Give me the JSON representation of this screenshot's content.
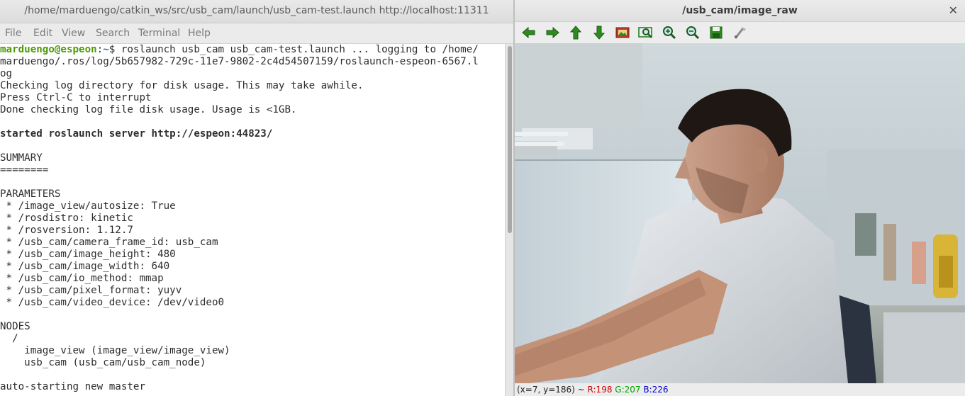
{
  "terminal": {
    "title": "/home/marduengo/catkin_ws/src/usb_cam/launch/usb_cam-test.launch http://localhost:11311",
    "menu": [
      "File",
      "Edit",
      "View",
      "Search",
      "Terminal",
      "Help"
    ],
    "prompt_user": "marduengo@espeon",
    "prompt_sep": ":",
    "prompt_path": "~",
    "prompt_cmd": "$ roslaunch usb_cam usb_cam-test.launch ... logging to /home/",
    "lines": [
      "marduengo/.ros/log/5b657982-729c-11e7-9802-2c4d54507159/roslaunch-espeon-6567.l",
      "og",
      "Checking log directory for disk usage. This may take awhile.",
      "Press Ctrl-C to interrupt",
      "Done checking log file disk usage. Usage is <1GB.",
      "",
      "started roslaunch server http://espeon:44823/",
      "",
      "SUMMARY",
      "========",
      "",
      "PARAMETERS",
      " * /image_view/autosize: True",
      " * /rosdistro: kinetic",
      " * /rosversion: 1.12.7",
      " * /usb_cam/camera_frame_id: usb_cam",
      " * /usb_cam/image_height: 480",
      " * /usb_cam/image_width: 640",
      " * /usb_cam/io_method: mmap",
      " * /usb_cam/pixel_format: yuyv",
      " * /usb_cam/video_device: /dev/video0",
      "",
      "NODES",
      "  /",
      "    image_view (image_view/image_view)",
      "    usb_cam (usb_cam/usb_cam_node)",
      "",
      "auto-starting new master"
    ]
  },
  "viewer": {
    "title": "/usb_cam/image_raw",
    "close_glyph": "✕",
    "toolbar": [
      {
        "name": "back-arrow-icon",
        "tooltip": "Back"
      },
      {
        "name": "forward-arrow-icon",
        "tooltip": "Forward"
      },
      {
        "name": "up-arrow-icon",
        "tooltip": "Up"
      },
      {
        "name": "down-arrow-icon",
        "tooltip": "Down"
      },
      {
        "name": "home-icon",
        "tooltip": "Reset original view"
      },
      {
        "name": "zoom-rect-icon",
        "tooltip": "Zoom to rectangle"
      },
      {
        "name": "zoom-in-icon",
        "tooltip": "Zoom in"
      },
      {
        "name": "zoom-out-icon",
        "tooltip": "Zoom out"
      },
      {
        "name": "save-icon",
        "tooltip": "Save"
      },
      {
        "name": "properties-icon",
        "tooltip": "Properties"
      }
    ],
    "status": {
      "coords": "(x=7, y=186) ~",
      "r": "R:198",
      "g": "G:207",
      "b": "B:226"
    }
  },
  "colors": {
    "prompt_user": "#4e9a06",
    "prompt_path": "#3465a4",
    "arrow_green": "#2e8b1f",
    "status_red": "#d00000",
    "status_green": "#00a000",
    "status_blue": "#0000d0"
  }
}
